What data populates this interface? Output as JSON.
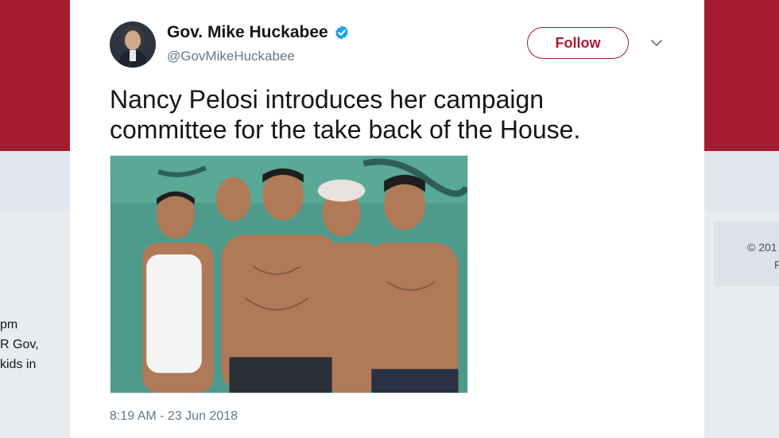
{
  "background": {
    "left_snippet_lines": [
      "pm",
      "R Gov,",
      "kids in"
    ],
    "right_snippet_lines": [
      "© 201",
      "F"
    ]
  },
  "tweet": {
    "author_name": "Gov. Mike Huckabee",
    "handle": "@GovMikeHuckabee",
    "verified": true,
    "follow_label": "Follow",
    "text": "Nancy Pelosi introduces her campaign committee for the take back of the House.",
    "timestamp": "8:19 AM - 23 Jun 2018"
  },
  "colors": {
    "brand_red": "#a51c30",
    "verified_blue": "#1da1f2",
    "muted_text": "#657786"
  },
  "icons": {
    "verified": "verified-badge-icon",
    "menu": "chevron-down-icon"
  }
}
